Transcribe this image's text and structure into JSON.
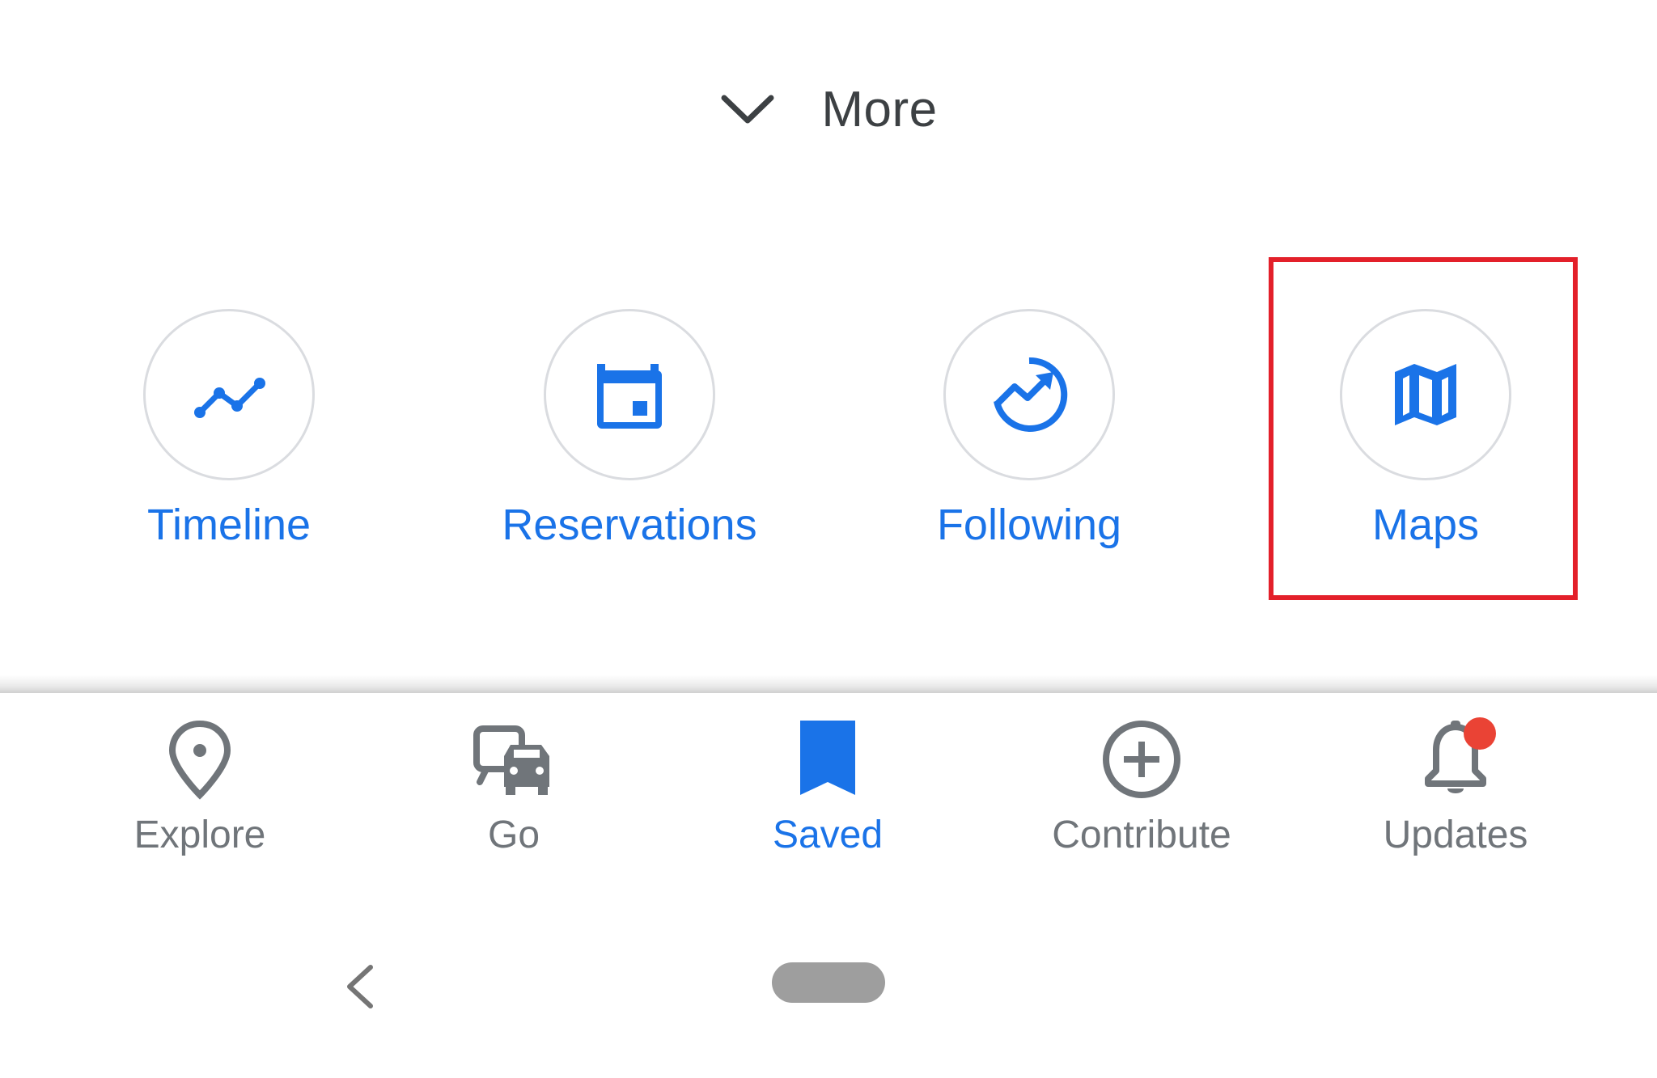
{
  "more": {
    "label": "More",
    "icon": "chevron-down-icon"
  },
  "actions": [
    {
      "label": "Timeline",
      "icon": "timeline-icon"
    },
    {
      "label": "Reservations",
      "icon": "calendar-icon"
    },
    {
      "label": "Following",
      "icon": "trending-icon"
    },
    {
      "label": "Maps",
      "icon": "map-icon"
    }
  ],
  "bottom_nav": [
    {
      "label": "Explore",
      "icon": "location-pin-icon",
      "active": false
    },
    {
      "label": "Go",
      "icon": "commute-icon",
      "active": false
    },
    {
      "label": "Saved",
      "icon": "bookmark-icon",
      "active": true
    },
    {
      "label": "Contribute",
      "icon": "add-circle-icon",
      "active": false
    },
    {
      "label": "Updates",
      "icon": "bell-icon",
      "active": false,
      "has_badge": true
    }
  ],
  "colors": {
    "accent": "#1a73e8",
    "inactive": "#70757a",
    "heading": "#3c4043",
    "badge": "#ea4335",
    "highlight": "#e3202a"
  }
}
